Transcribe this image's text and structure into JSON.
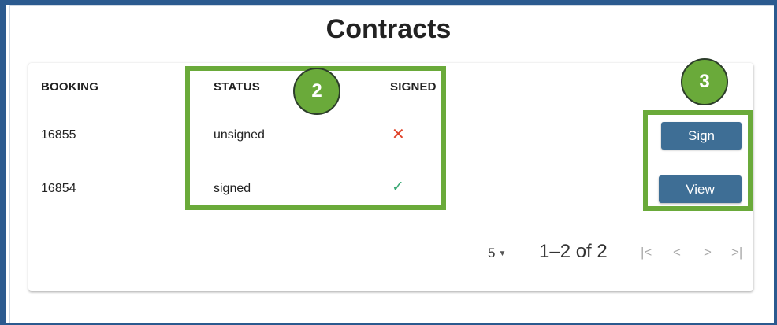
{
  "page": {
    "title": "Contracts"
  },
  "table": {
    "headers": {
      "booking": "BOOKING",
      "status": "STATUS",
      "signed": "SIGNED"
    },
    "rows": [
      {
        "booking": "16855",
        "status": "unsigned",
        "signed_icon": "x-icon",
        "signed_glyph": "✕",
        "action": "Sign"
      },
      {
        "booking": "16854",
        "status": "signed",
        "signed_icon": "check-icon",
        "signed_glyph": "✓",
        "action": "View"
      }
    ]
  },
  "pagination": {
    "rows_per_page": "5",
    "caret": "▼",
    "range": "1–2 of 2",
    "first": "|<",
    "prev": "<",
    "next": ">",
    "last": ">|"
  },
  "annotations": {
    "callout_2": "2",
    "callout_3": "3"
  },
  "colors": {
    "frame": "#2b5a8f",
    "button": "#3e6e95",
    "callout": "#6aaa3a",
    "unsigned_x": "#e0442b",
    "signed_check": "#3aa874"
  }
}
